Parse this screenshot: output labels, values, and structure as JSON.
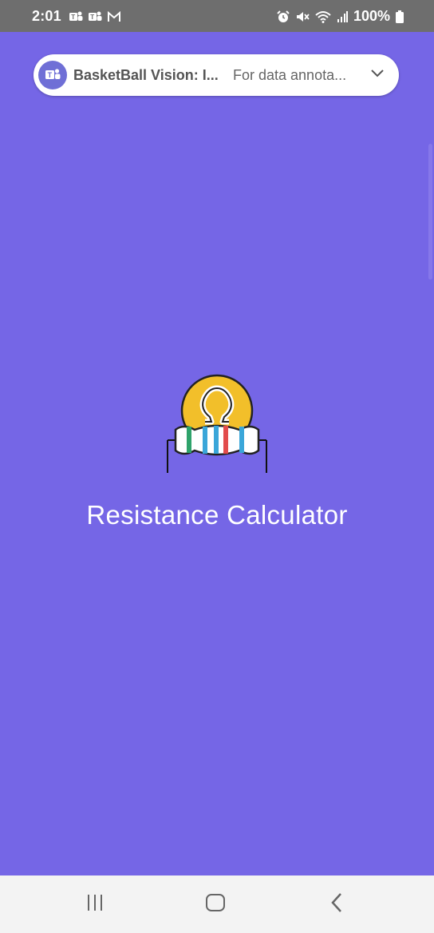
{
  "status_bar": {
    "time": "2:01",
    "left_icons": [
      "teams-icon",
      "teams-icon",
      "gmail-icon"
    ],
    "right_icons": [
      "alarm-icon",
      "mute-icon",
      "wifi-icon",
      "signal-icon"
    ],
    "battery_text": "100%"
  },
  "notification": {
    "app_icon": "teams-icon",
    "title": "BasketBall Vision: I...",
    "text": "For data annota...",
    "expand_icon": "chevron-down-icon"
  },
  "splash": {
    "logo_icon": "resistor-ohm-logo",
    "title": "Resistance Calculator"
  },
  "nav_bar": {
    "recents_icon": "recents-icon",
    "home_icon": "home-icon",
    "back_icon": "back-icon"
  },
  "colors": {
    "background": "#7566e6",
    "logo_circle": "#f2bf2a",
    "status_bar": "#6e6e6e",
    "nav_bar": "#f3f3f3"
  }
}
